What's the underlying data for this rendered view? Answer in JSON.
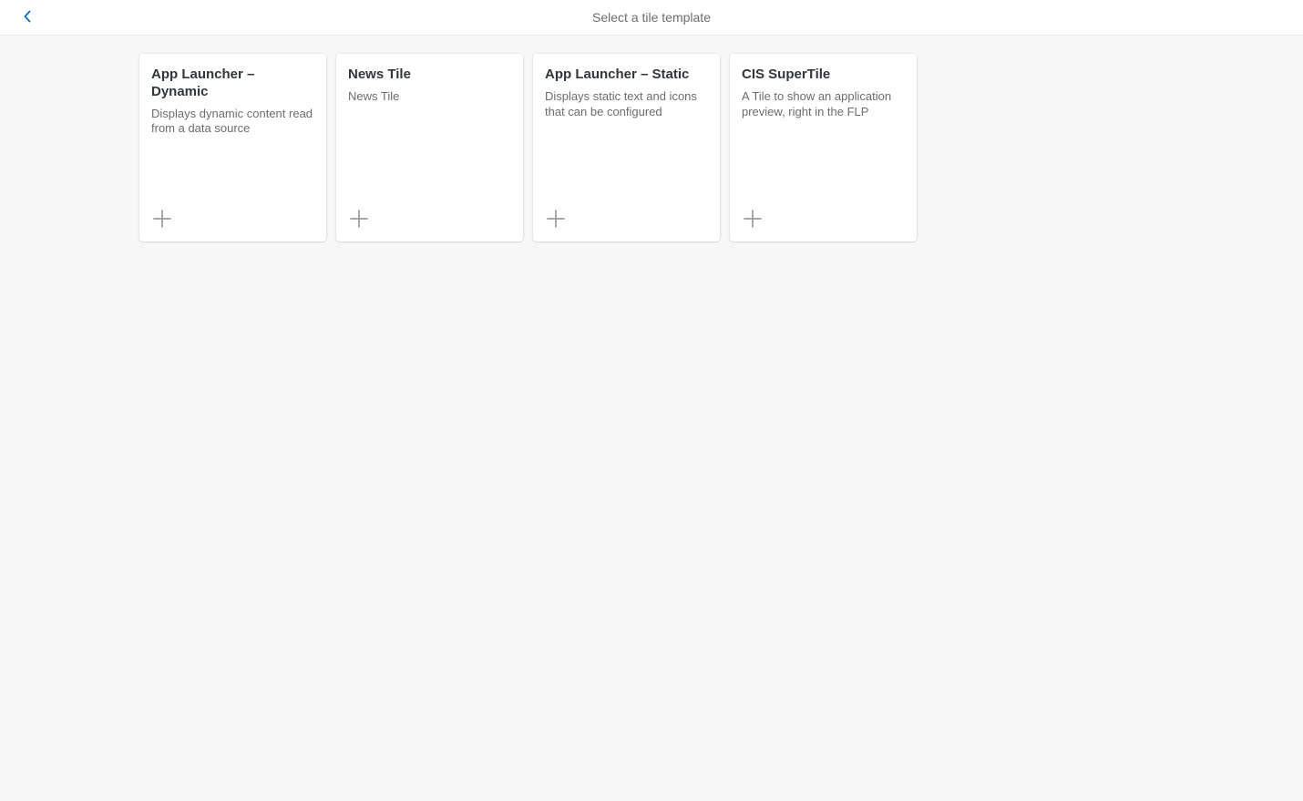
{
  "header": {
    "title": "Select a tile template"
  },
  "tiles": [
    {
      "title": "App Launcher – Dynamic",
      "description": "Displays dynamic content read from a data source"
    },
    {
      "title": "News Tile",
      "description": "News Tile"
    },
    {
      "title": "App Launcher – Static",
      "description": "Displays static text and icons that can be configured"
    },
    {
      "title": "CIS SuperTile",
      "description": "A Tile to show an application preview, right in the FLP"
    }
  ]
}
